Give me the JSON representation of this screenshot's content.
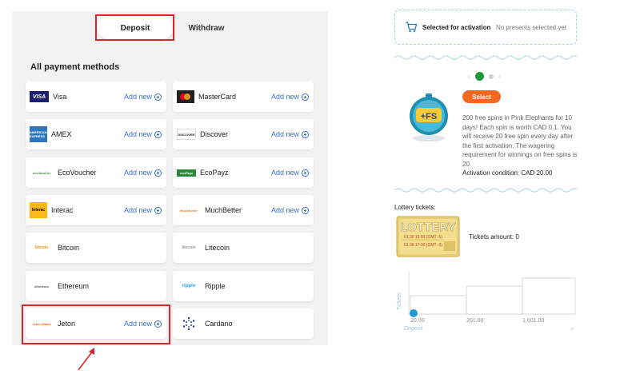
{
  "tabs": {
    "deposit": "Deposit",
    "withdraw": "Withdraw"
  },
  "section_title": "All payment methods",
  "add_label": "Add new",
  "methods": [
    {
      "name": "Visa",
      "logo": "VISA",
      "icon": "visa-logo",
      "add": true
    },
    {
      "name": "MasterCard",
      "logo": "mastercard",
      "icon": "mastercard-logo",
      "add": true
    },
    {
      "name": "AMEX",
      "logo": "AMERICAN EXPRESS",
      "icon": "amex-logo",
      "add": true
    },
    {
      "name": "Discover",
      "logo": "DISCOVER",
      "icon": "discover-logo",
      "add": true
    },
    {
      "name": "EcoVoucher",
      "logo": "ecoVoucher",
      "icon": "ecovoucher-logo",
      "add": true
    },
    {
      "name": "EcoPayz",
      "logo": "ecoPayz",
      "icon": "ecopayz-logo",
      "add": true
    },
    {
      "name": "Interac",
      "logo": "Interac",
      "icon": "interac-logo",
      "add": true
    },
    {
      "name": "MuchBetter",
      "logo": "MuchBetter",
      "icon": "muchbetter-logo",
      "add": true
    },
    {
      "name": "Bitcoin",
      "logo": "bitcoin",
      "icon": "bitcoin-logo",
      "add": false
    },
    {
      "name": "Litecoin",
      "logo": "litecoin",
      "icon": "litecoin-logo",
      "add": false
    },
    {
      "name": "Ethereum",
      "logo": "ethereum",
      "icon": "ethereum-logo",
      "add": false
    },
    {
      "name": "Ripple",
      "logo": "ripple",
      "icon": "ripple-logo",
      "add": false
    },
    {
      "name": "Jeton",
      "logo": "Jeton Wallet",
      "icon": "jeton-logo",
      "add": true
    },
    {
      "name": "Cardano",
      "logo": "CARDANO",
      "icon": "cardano-logo",
      "add": false
    }
  ],
  "selection": {
    "label": "Selected for activation",
    "status": "No presents selected yet"
  },
  "promo": {
    "badge": "+FS",
    "select_label": "Select",
    "description": "200 free spins in Pink Elephants for 10 days! Each spin is worth CAD 0.1. You will receive 20 free spin every day after the first activation. The wagering requirement for winnings on free spins is 20.",
    "activation": "Activation condition: CAD 20.00"
  },
  "lottery": {
    "title": "Lottery tickets:",
    "ticket_word": "LOTTERY",
    "dates": [
      "01.30 19:00 (GMT -5)",
      "02.08 17:00 (GMT -5)"
    ],
    "amount": "Tickets amount: 0"
  },
  "chart_data": {
    "type": "step",
    "ylabel": "Tickets",
    "xlabel": "Deposit",
    "tick_labels": [
      "20.00",
      "201.00",
      "1,001.00"
    ],
    "x": [
      20,
      201,
      1001
    ],
    "current_value": 20
  },
  "colors": {
    "accent": "#3b6fc9",
    "highlight": "#d9262c",
    "select": "#f26a21",
    "active_dot": "#1f9a3a"
  }
}
